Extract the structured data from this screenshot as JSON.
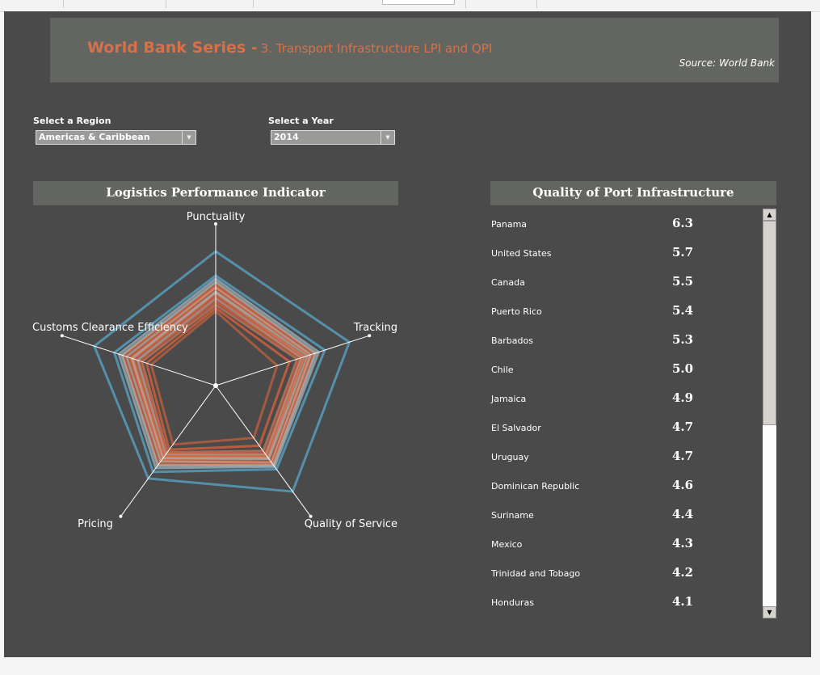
{
  "header": {
    "title": "World Bank Series -",
    "subtitle": "3. Transport Infrastructure LPI and QPI",
    "source": "Source: World Bank"
  },
  "filters": {
    "region": {
      "label": "Select a Region",
      "value": "Americas & Caribbean"
    },
    "year": {
      "label": "Select a Year",
      "value": "2014"
    }
  },
  "lpi_panel": {
    "title": "Logistics Performance Indicator"
  },
  "qpi_panel": {
    "title": "Quality of Port Infrastructure"
  },
  "chart_data": {
    "type": "radar",
    "axes": [
      "Punctuality",
      "Tracking",
      "Quality of Service",
      "Pricing",
      "Customs Clearance Efficiency"
    ],
    "scale": "relative level (fraction of axis length)",
    "colors": {
      "high": "#5aa8cc",
      "low": "#e0623a",
      "mid": "#b9b4b0"
    },
    "series": [
      {
        "values": [
          0.83,
          0.87,
          0.81,
          0.71,
          0.79
        ],
        "color": "#5aa8cc"
      },
      {
        "values": [
          0.68,
          0.71,
          0.64,
          0.66,
          0.66
        ],
        "color": "#5aa8cc"
      },
      {
        "values": [
          0.66,
          0.67,
          0.62,
          0.63,
          0.63
        ],
        "color": "#9bb6c2"
      },
      {
        "values": [
          0.64,
          0.65,
          0.61,
          0.61,
          0.61
        ],
        "color": "#b9b4b0"
      },
      {
        "values": [
          0.62,
          0.64,
          0.6,
          0.6,
          0.6
        ],
        "color": "#e0623a"
      },
      {
        "values": [
          0.61,
          0.62,
          0.59,
          0.58,
          0.58
        ],
        "color": "#c9a79a"
      },
      {
        "values": [
          0.6,
          0.61,
          0.58,
          0.57,
          0.56
        ],
        "color": "#e0623a"
      },
      {
        "values": [
          0.58,
          0.6,
          0.56,
          0.56,
          0.55
        ],
        "color": "#b9b4b0"
      },
      {
        "values": [
          0.57,
          0.58,
          0.55,
          0.55,
          0.54
        ],
        "color": "#d88464"
      },
      {
        "values": [
          0.55,
          0.57,
          0.54,
          0.54,
          0.53
        ],
        "color": "#e0623a"
      },
      {
        "values": [
          0.54,
          0.56,
          0.53,
          0.53,
          0.51
        ],
        "color": "#a8a6a4"
      },
      {
        "values": [
          0.52,
          0.55,
          0.52,
          0.52,
          0.5
        ],
        "color": "#e0623a"
      },
      {
        "values": [
          0.5,
          0.53,
          0.5,
          0.51,
          0.48
        ],
        "color": "#c97a5c"
      },
      {
        "values": [
          0.48,
          0.48,
          0.46,
          0.49,
          0.45
        ],
        "color": "#e0623a"
      },
      {
        "values": [
          0.46,
          0.4,
          0.4,
          0.45,
          0.42
        ],
        "color": "#c0603e"
      }
    ]
  },
  "qpi_rows": [
    {
      "country": "Panama",
      "value": "6.3"
    },
    {
      "country": "United States",
      "value": "5.7"
    },
    {
      "country": "Canada",
      "value": "5.5"
    },
    {
      "country": "Puerto Rico",
      "value": "5.4"
    },
    {
      "country": "Barbados",
      "value": "5.3"
    },
    {
      "country": "Chile",
      "value": "5.0"
    },
    {
      "country": "Jamaica",
      "value": "4.9"
    },
    {
      "country": "El Salvador",
      "value": "4.7"
    },
    {
      "country": "Uruguay",
      "value": "4.7"
    },
    {
      "country": "Dominican Republic",
      "value": "4.6"
    },
    {
      "country": "Suriname",
      "value": "4.4"
    },
    {
      "country": "Mexico",
      "value": "4.3"
    },
    {
      "country": "Trinidad and Tobago",
      "value": "4.2"
    },
    {
      "country": "Honduras",
      "value": "4.1"
    }
  ],
  "icons": {
    "dropdown": "chevron-down-icon",
    "scroll_up": "arrow-up-icon",
    "scroll_down": "arrow-down-icon"
  }
}
